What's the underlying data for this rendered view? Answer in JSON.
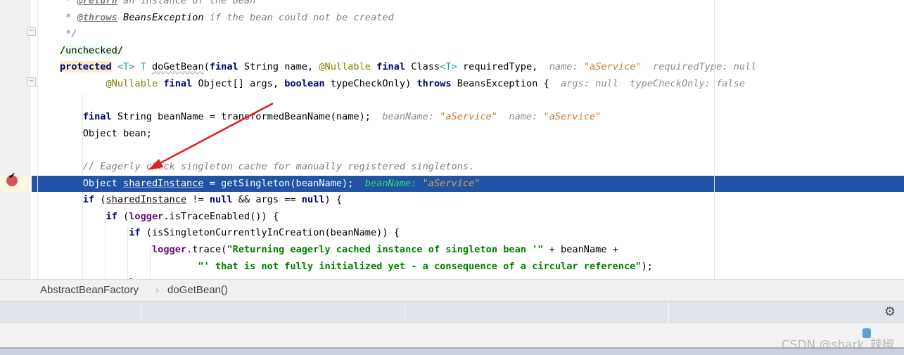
{
  "editor": {
    "lines": [
      [
        [
          "cm",
          " * "
        ],
        [
          "tag",
          "@return"
        ],
        [
          "cm",
          " an instance of the bean"
        ]
      ],
      [
        [
          "cm",
          " * "
        ],
        [
          "tag",
          "@throws"
        ],
        [
          "doc",
          " BeansException"
        ],
        [
          "cm",
          " if the bean could not be created"
        ]
      ],
      [
        [
          "cm",
          " */"
        ]
      ],
      [
        [
          "unchk",
          "/unchecked/"
        ]
      ],
      [
        [
          "kw prot",
          "protected"
        ],
        [
          "pl",
          " "
        ],
        [
          "tp",
          "<T> T"
        ],
        [
          "pl",
          " "
        ],
        [
          "wavy",
          "doGetBean"
        ],
        [
          "pl",
          "("
        ],
        [
          "kw",
          "final"
        ],
        [
          "pl",
          " String name, "
        ],
        [
          "an",
          "@Nullable"
        ],
        [
          "pl",
          " "
        ],
        [
          "kw",
          "final"
        ],
        [
          "pl",
          " Class"
        ],
        [
          "tp",
          "<T>"
        ],
        [
          "pl",
          " requiredType,  "
        ],
        [
          "hint",
          "name: "
        ],
        [
          "hintv",
          "\"aService\""
        ],
        [
          "hint",
          "  requiredType: null"
        ]
      ],
      [
        [
          "pl",
          "        "
        ],
        [
          "an",
          "@Nullable"
        ],
        [
          "pl",
          " "
        ],
        [
          "kw",
          "final"
        ],
        [
          "pl",
          " Object[] args, "
        ],
        [
          "kw",
          "boolean"
        ],
        [
          "pl",
          " typeCheckOnly) "
        ],
        [
          "kw",
          "throws"
        ],
        [
          "pl",
          " BeansException {  "
        ],
        [
          "hint",
          "args: null  typeCheckOnly: false"
        ]
      ],
      [],
      [
        [
          "pl",
          "    "
        ],
        [
          "kw",
          "final"
        ],
        [
          "pl",
          " String beanName = transformedBeanName(name);  "
        ],
        [
          "hint",
          "beanName: "
        ],
        [
          "hintv",
          "\"aService\""
        ],
        [
          "hint",
          "  name: "
        ],
        [
          "hintv",
          "\"aService\""
        ]
      ],
      [
        [
          "pl",
          "    Object bean;"
        ]
      ],
      [],
      [
        [
          "pl",
          "    "
        ],
        [
          "cm",
          "// Eagerly check singleton cache for manually registered singletons."
        ]
      ],
      [
        [
          "pl",
          "    Object "
        ],
        [
          "ul",
          "sharedInstance"
        ],
        [
          "pl",
          " = getSingleton(beanName);  "
        ],
        [
          "hint",
          "beanName: "
        ],
        [
          "hintv",
          "\"aService\""
        ]
      ],
      [
        [
          "pl",
          "    "
        ],
        [
          "kw",
          "if"
        ],
        [
          "pl",
          " ("
        ],
        [
          "ul",
          "sharedInstance"
        ],
        [
          "pl",
          " != "
        ],
        [
          "kw",
          "null"
        ],
        [
          "pl",
          " && args == "
        ],
        [
          "kw",
          "null"
        ],
        [
          "pl",
          ") {"
        ]
      ],
      [
        [
          "pl",
          "        "
        ],
        [
          "kw",
          "if"
        ],
        [
          "pl",
          " ("
        ],
        [
          "fld",
          "logger"
        ],
        [
          "pl",
          ".isTraceEnabled()) {"
        ]
      ],
      [
        [
          "pl",
          "            "
        ],
        [
          "kw",
          "if"
        ],
        [
          "pl",
          " (isSingletonCurrentlyInCreation(beanName)) {"
        ]
      ],
      [
        [
          "pl",
          "                "
        ],
        [
          "fld",
          "logger"
        ],
        [
          "pl",
          ".trace("
        ],
        [
          "str",
          "\"Returning eagerly cached instance of singleton bean '\""
        ],
        [
          "pl",
          " + beanName +"
        ]
      ],
      [
        [
          "pl",
          "                        "
        ],
        [
          "str",
          "\"' that is not fully initialized yet - a consequence of a circular reference\""
        ],
        [
          "pl",
          ");"
        ]
      ],
      [
        [
          "pl",
          "            }"
        ]
      ]
    ],
    "current_line": 11,
    "highlight_color": "#2154a6",
    "breakpoint_icon": "breakpoint-check-icon"
  },
  "breadcrumb": {
    "items": [
      "AbstractBeanFactory",
      "doGetBean()"
    ],
    "separator": "›"
  },
  "panel": {
    "gear_icon": "gear-icon"
  },
  "watermark": "CSDN @shark_辣椒"
}
